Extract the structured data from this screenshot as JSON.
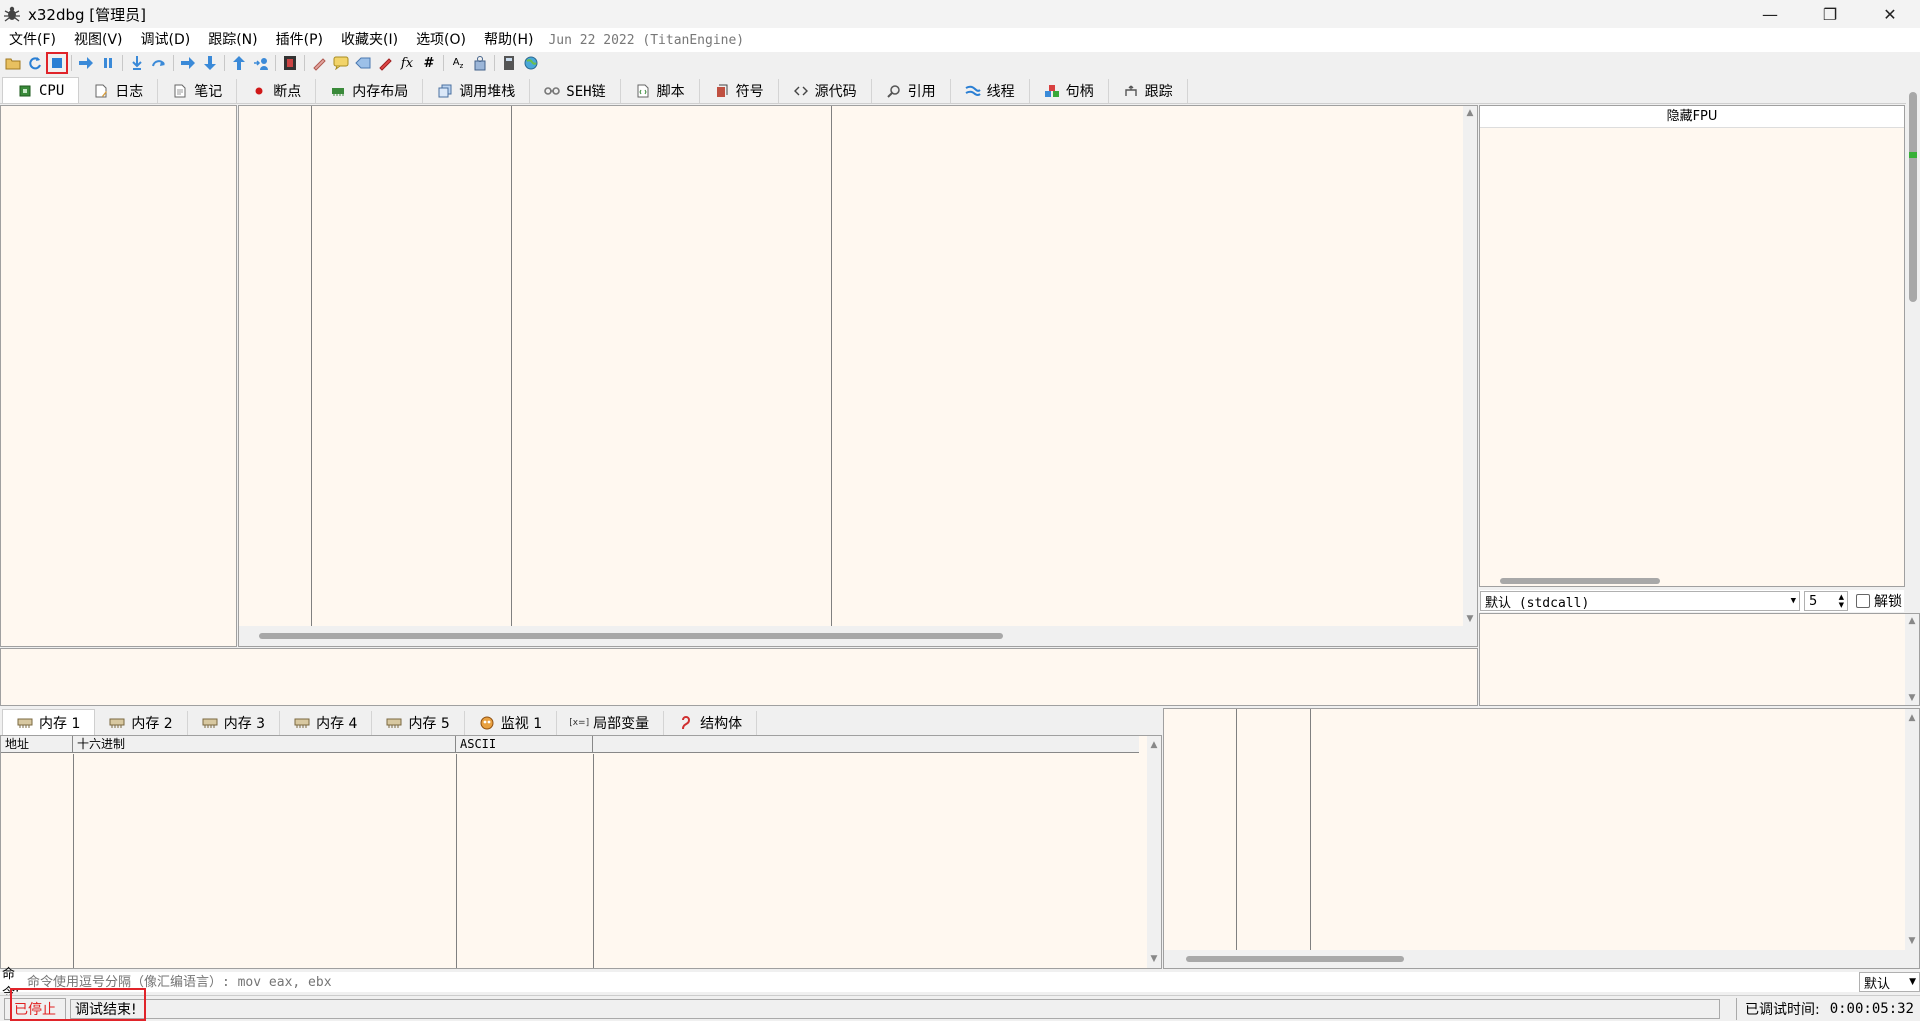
{
  "window": {
    "title": "x32dbg [管理员]",
    "controls": {
      "minimize": "—",
      "restore": "❐",
      "close": "✕"
    }
  },
  "menu": {
    "items": [
      "文件(F)",
      "视图(V)",
      "调试(D)",
      "跟踪(N)",
      "插件(P)",
      "收藏夹(I)",
      "选项(O)",
      "帮助(H)"
    ],
    "build": "Jun 22 2022 (TitanEngine)"
  },
  "toolbar": {
    "icons": [
      "open-icon",
      "restart-icon",
      "stop-icon",
      "run-icon",
      "pause-icon",
      "step-into-icon",
      "step-over-icon",
      "trace-into-icon",
      "trace-over-icon",
      "execute-till-return-icon",
      "run-to-user-code-icon",
      "scylla-icon",
      "patch-icon",
      "comments-icon",
      "labels-icon",
      "bookmarks-icon",
      "functions-icon",
      "hash-icon",
      "strings-icon",
      "find-icon",
      "calculator-icon",
      "globe-icon"
    ]
  },
  "main_tabs": [
    {
      "label": "CPU",
      "icon": "cpu-icon"
    },
    {
      "label": "日志",
      "icon": "log-icon"
    },
    {
      "label": "笔记",
      "icon": "notes-icon"
    },
    {
      "label": "断点",
      "icon": "breakpoint-icon"
    },
    {
      "label": "内存布局",
      "icon": "memory-map-icon"
    },
    {
      "label": "调用堆栈",
      "icon": "call-stack-icon"
    },
    {
      "label": "SEH链",
      "icon": "seh-icon"
    },
    {
      "label": "脚本",
      "icon": "script-icon"
    },
    {
      "label": "符号",
      "icon": "symbols-icon"
    },
    {
      "label": "源代码",
      "icon": "source-icon"
    },
    {
      "label": "引用",
      "icon": "references-icon"
    },
    {
      "label": "线程",
      "icon": "threads-icon"
    },
    {
      "label": "句柄",
      "icon": "handles-icon"
    },
    {
      "label": "跟踪",
      "icon": "trace-icon"
    }
  ],
  "registers": {
    "toggle_label": "隐藏FPU",
    "callconv": "默认 (stdcall)",
    "arg_count": "5",
    "unlock_label": "解锁"
  },
  "mem_tabs": [
    {
      "label": "内存 1"
    },
    {
      "label": "内存 2"
    },
    {
      "label": "内存 3"
    },
    {
      "label": "内存 4"
    },
    {
      "label": "内存 5"
    },
    {
      "label": "监视 1"
    },
    {
      "label": "局部变量"
    },
    {
      "label": "结构体"
    }
  ],
  "dump_headers": [
    "地址",
    "十六进制",
    "ASCII",
    ""
  ],
  "command": {
    "label": "命令:",
    "placeholder": "命令使用逗号分隔（像汇编语言）: mov eax, ebx",
    "mode": "默认"
  },
  "status": {
    "state": "已停止",
    "message": "调试结束!",
    "time_label": "已调试时间:",
    "time_value": "0:00:05:32"
  },
  "colors": {
    "panel_bg": "#fff8f0",
    "highlight": "#e0242a",
    "stopped": "#e02020"
  }
}
